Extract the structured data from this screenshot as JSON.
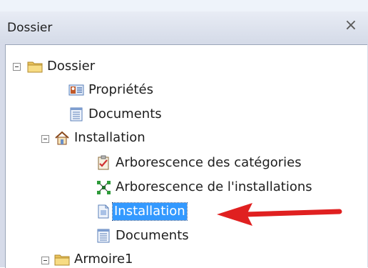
{
  "panel": {
    "title": "Dossier",
    "close_glyph": "×"
  },
  "tree": {
    "root_label": "Dossier",
    "items": {
      "proprietes": "Propriétés",
      "documents_1": "Documents",
      "installation_parent": "Installation",
      "arbo_categories": "Arborescence des catégories",
      "arbo_installations": "Arborescence de l'installations",
      "installation_selected": "Installation",
      "documents_2": "Documents",
      "armoire": "Armoire1"
    }
  },
  "icons": {
    "root": "folder-icon",
    "proprietes": "properties-card-icon",
    "documents": "document-list-icon",
    "installation": "house-icon",
    "arbo_categories": "checklist-clipboard-icon",
    "arbo_installations": "network-tree-icon",
    "installation_doc": "page-icon",
    "armoire": "folder-icon"
  },
  "annotation": {
    "arrow_color": "#e02020",
    "selection_color": "#3399ff"
  }
}
